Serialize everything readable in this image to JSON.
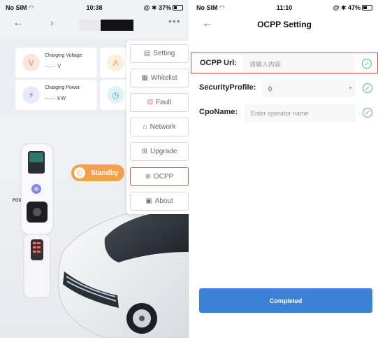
{
  "left_screen": {
    "status": {
      "carrier": "No SIM",
      "time": "10:38",
      "battery": "37%",
      "battery_fraction": 0.37
    },
    "nav": {
      "back_icon": "arrow-left-icon",
      "chevron_icon": "chevron-right-icon",
      "more_icon": "more-dots-icon",
      "more_label": "•••"
    },
    "cards": [
      {
        "label": "Charging Voltage",
        "value": "--.-- V",
        "icon": "voltage-icon",
        "color": "#e0856f"
      },
      {
        "label": "",
        "value": "",
        "icon": "current-icon",
        "color": "#f0a94e"
      },
      {
        "label": "Charging Power",
        "value": "--.-- kW",
        "icon": "power-icon",
        "color": "#6a7fd6"
      },
      {
        "label": "",
        "value": "",
        "icon": "clock-icon",
        "color": "#3fb3c7"
      }
    ],
    "menu": [
      {
        "label": "Setting",
        "icon": "setting-icon"
      },
      {
        "label": "Whitelist",
        "icon": "whitelist-icon"
      },
      {
        "label": "Fault",
        "icon": "fault-icon"
      },
      {
        "label": "Network",
        "icon": "network-icon"
      },
      {
        "label": "Upgrade",
        "icon": "upgrade-icon"
      },
      {
        "label": "OCPP",
        "icon": "globe-icon",
        "highlighted": true
      },
      {
        "label": "About",
        "icon": "about-icon"
      }
    ],
    "standby_label": "Standby",
    "charger_brand": "FOX"
  },
  "right_screen": {
    "status": {
      "carrier": "No SIM",
      "time": "11:10",
      "battery": "47%",
      "battery_fraction": 0.47
    },
    "nav": {
      "back_icon": "arrow-left-icon",
      "title": "OCPP Setting"
    },
    "fields": {
      "ocpp_url": {
        "label": "OCPP Url:",
        "placeholder": "请输入内容",
        "value": ""
      },
      "security_profile": {
        "label": "SecurityProfile:",
        "value": "0"
      },
      "cpo_name": {
        "label": "CpoName:",
        "placeholder": "Enter operator name",
        "value": ""
      }
    },
    "completed_label": "Completed"
  },
  "colors": {
    "accent_blue": "#3b82d6",
    "highlight_red": "#e2533c",
    "check_green": "#4cbf6b",
    "standby_orange": "#f4a14a"
  }
}
